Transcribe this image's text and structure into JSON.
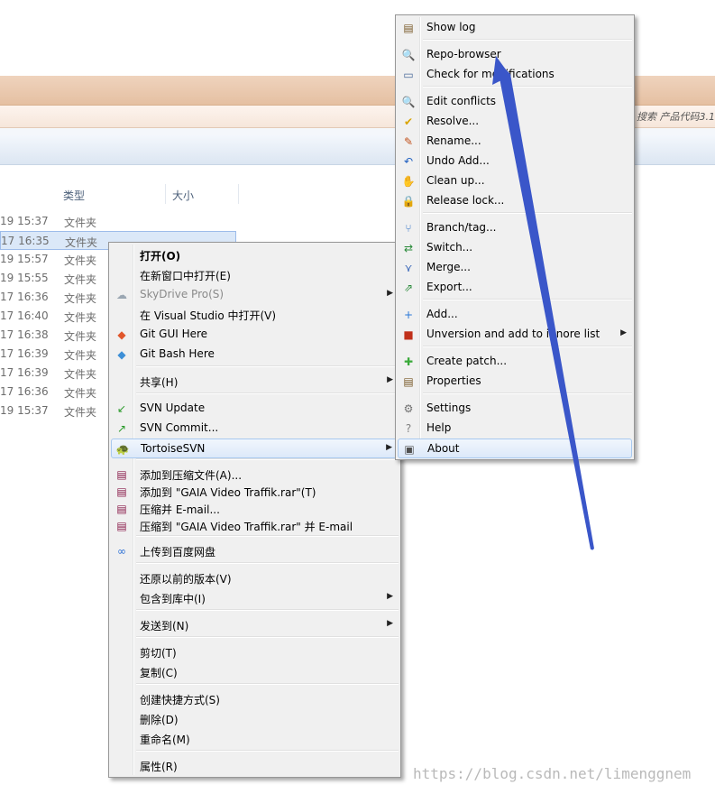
{
  "explorer": {
    "search_hint": "搜索 产品代码3.1",
    "columns": [
      "类型",
      "大小"
    ],
    "files": [
      {
        "date": "19 15:37",
        "type": "文件夹",
        "selected": false
      },
      {
        "date": "17 16:35",
        "type": "文件夹",
        "selected": true
      },
      {
        "date": "19 15:57",
        "type": "文件夹",
        "selected": false
      },
      {
        "date": "19 15:55",
        "type": "文件夹",
        "selected": false
      },
      {
        "date": "17 16:36",
        "type": "文件夹",
        "selected": false
      },
      {
        "date": "17 16:40",
        "type": "文件夹",
        "selected": false
      },
      {
        "date": "17 16:38",
        "type": "文件夹",
        "selected": false
      },
      {
        "date": "17 16:39",
        "type": "文件夹",
        "selected": false
      },
      {
        "date": "17 16:39",
        "type": "文件夹",
        "selected": false
      },
      {
        "date": "17 16:36",
        "type": "文件夹",
        "selected": false
      },
      {
        "date": "19 15:37",
        "type": "文件夹",
        "selected": false
      }
    ]
  },
  "context_menu": {
    "items": [
      {
        "label": "打开(O)",
        "bold": true
      },
      {
        "label": "在新窗口中打开(E)"
      },
      {
        "label": "SkyDrive Pro(S)",
        "icon": "cloud-icon",
        "submenu": true,
        "disabled": true
      },
      {
        "label": "在 Visual Studio 中打开(V)"
      },
      {
        "label": "Git GUI Here",
        "icon": "git-gui-icon"
      },
      {
        "label": "Git Bash Here",
        "icon": "git-bash-icon"
      },
      {
        "label": "共享(H)",
        "submenu": true
      },
      {
        "label": "SVN Update",
        "icon": "svn-update-icon"
      },
      {
        "label": "SVN Commit...",
        "icon": "svn-commit-icon"
      },
      {
        "label": "TortoiseSVN",
        "icon": "tortoise-icon",
        "submenu": true,
        "highlighted": true
      },
      {
        "label": "添加到压缩文件(A)...",
        "icon": "winrar-icon"
      },
      {
        "label": "添加到 \"GAIA Video Traffik.rar\"(T)",
        "icon": "winrar-icon"
      },
      {
        "label": "压缩并 E-mail...",
        "icon": "winrar-icon"
      },
      {
        "label": "压缩到 \"GAIA Video Traffik.rar\" 并 E-mail",
        "icon": "winrar-icon"
      },
      {
        "label": "上传到百度网盘",
        "icon": "baidu-cloud-icon"
      },
      {
        "label": "还原以前的版本(V)"
      },
      {
        "label": "包含到库中(I)",
        "submenu": true
      },
      {
        "label": "发送到(N)",
        "submenu": true
      },
      {
        "label": "剪切(T)"
      },
      {
        "label": "复制(C)"
      },
      {
        "label": "创建快捷方式(S)"
      },
      {
        "label": "删除(D)"
      },
      {
        "label": "重命名(M)"
      },
      {
        "label": "属性(R)"
      }
    ]
  },
  "svn_submenu": {
    "items": [
      {
        "label": "Show log",
        "icon": "log-icon"
      },
      {
        "label": "Repo-browser",
        "icon": "repo-browser-icon"
      },
      {
        "label": "Check for modifications",
        "icon": "check-modifications-icon"
      },
      {
        "label": "Edit conflicts",
        "icon": "edit-conflicts-icon"
      },
      {
        "label": "Resolve...",
        "icon": "resolve-icon"
      },
      {
        "label": "Rename...",
        "icon": "rename-icon"
      },
      {
        "label": "Undo Add...",
        "icon": "undo-icon"
      },
      {
        "label": "Clean up...",
        "icon": "cleanup-icon"
      },
      {
        "label": "Release lock...",
        "icon": "lock-icon"
      },
      {
        "label": "Branch/tag...",
        "icon": "branch-icon"
      },
      {
        "label": "Switch...",
        "icon": "switch-icon"
      },
      {
        "label": "Merge...",
        "icon": "merge-icon"
      },
      {
        "label": "Export...",
        "icon": "export-icon"
      },
      {
        "label": "Add...",
        "icon": "add-icon"
      },
      {
        "label": "Unversion and add to ignore list",
        "icon": "ignore-icon",
        "submenu": true
      },
      {
        "label": "Create patch...",
        "icon": "patch-icon"
      },
      {
        "label": "Properties",
        "icon": "properties-icon"
      },
      {
        "label": "Settings",
        "icon": "settings-icon"
      },
      {
        "label": "Help",
        "icon": "help-icon"
      },
      {
        "label": "About",
        "icon": "about-icon",
        "highlighted": true
      }
    ]
  },
  "annotation_arrow": {
    "color": "#3a56c9",
    "points_to": "Repo-browser"
  },
  "watermark": "https://blog.csdn.net/limenggnem"
}
